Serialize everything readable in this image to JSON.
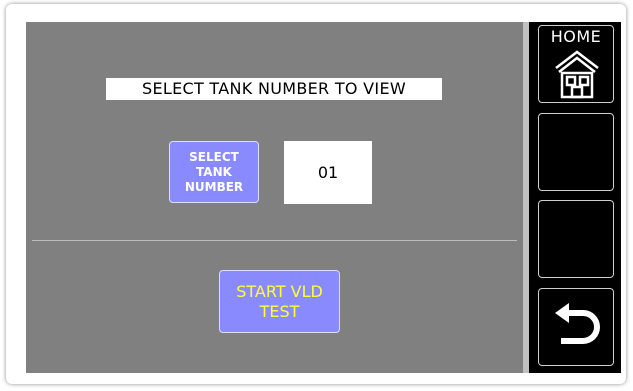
{
  "main": {
    "title": "SELECT TANK NUMBER TO VIEW",
    "select_tank_button": "SELECT\nTANK\nNUMBER",
    "tank_number_value": "01",
    "start_vld_button": "START VLD\nTEST"
  },
  "sidebar": {
    "home_label": "HOME",
    "home_icon": "house-icon",
    "back_icon": "return-arrow-icon"
  },
  "colors": {
    "panel_background": "#808080",
    "button_blue": "#8a8aff",
    "start_text_yellow": "#ffff33",
    "sidebar_background": "#000000"
  }
}
